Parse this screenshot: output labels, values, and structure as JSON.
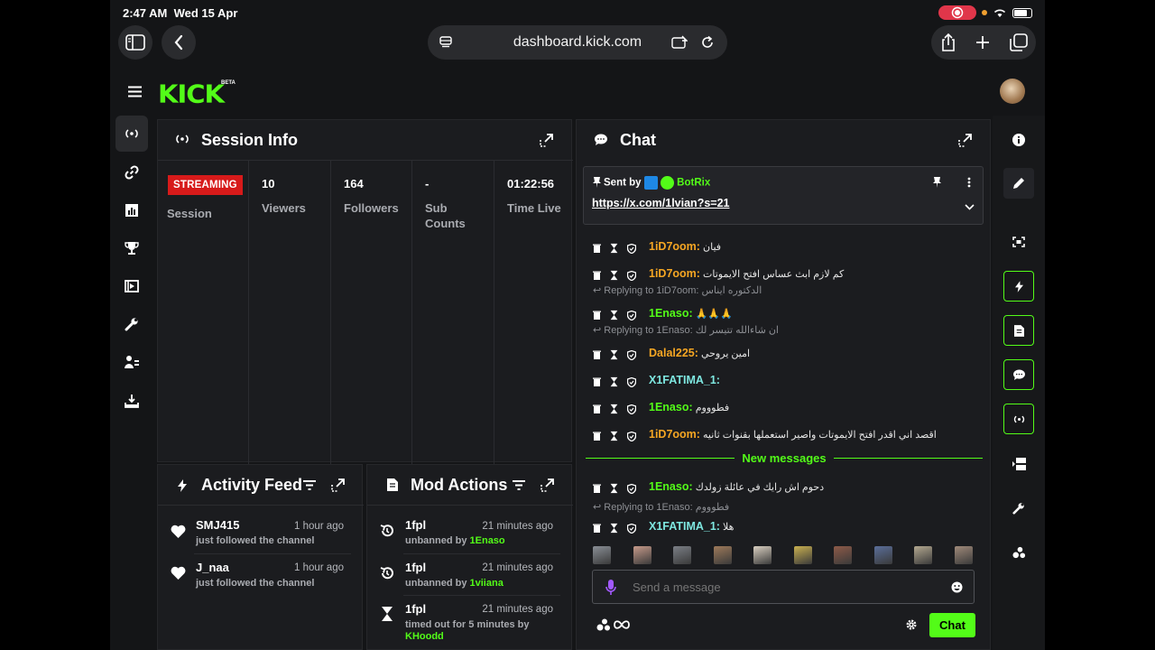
{
  "status": {
    "time": "2:47 AM",
    "date": "Wed 15 Apr"
  },
  "browser": {
    "url": "dashboard.kick.com"
  },
  "brand": {
    "logo": "KICK",
    "beta": "BETA",
    "accent": "#53fc18"
  },
  "session": {
    "title": "Session Info",
    "badge": "STREAMING",
    "badge_label": "Session",
    "stats": [
      {
        "value": "10",
        "label": "Viewers"
      },
      {
        "value": "164",
        "label": "Followers"
      },
      {
        "value": "-",
        "label": "Sub Counts"
      },
      {
        "value": "01:22:56",
        "label": "Time Live"
      }
    ]
  },
  "activity": {
    "title": "Activity Feed",
    "items": [
      {
        "user": "SMJ415",
        "time": "1 hour ago",
        "text": "just followed the channel"
      },
      {
        "user": "J_naa",
        "time": "1 hour ago",
        "text": "just followed the channel"
      }
    ]
  },
  "mod": {
    "title": "Mod Actions",
    "items": [
      {
        "user": "1fpl",
        "time": "21 minutes ago",
        "action": "unbanned by",
        "by": "1Enaso"
      },
      {
        "user": "1fpl",
        "time": "21 minutes ago",
        "action": "unbanned by",
        "by": "1viiana"
      },
      {
        "user": "1fpl",
        "time": "21 minutes ago",
        "action": "timed out for 5 minutes by",
        "by": "KHoodd"
      }
    ]
  },
  "chat": {
    "title": "Chat",
    "pinned": {
      "sent_by": "Sent by",
      "bot": "BotRix",
      "link": "https://x.com/1lvian?s=21"
    },
    "messages": [
      {
        "user": "1iD7oom:",
        "color": "#f5a623",
        "text": "فيان"
      },
      {
        "user": "1iD7oom:",
        "color": "#f5a623",
        "text": "كم لازم ابث عساس افتح الايموتات"
      },
      {
        "reply": "Replying to 1iD7oom: الدكتوره ايناس",
        "user": "1Enaso:",
        "color": "#53fc18",
        "text": "🙏🙏🙏"
      },
      {
        "reply": "Replying to 1Enaso: ان شاءالله تتيسر لك",
        "user": "Dalal225:",
        "color": "#f5a623",
        "text": "امين يروحي"
      },
      {
        "user": "X1FATIMA_1:",
        "color": "#7ee7e0",
        "text": ""
      },
      {
        "user": "1Enaso:",
        "color": "#53fc18",
        "text": "فطوووم"
      },
      {
        "user": "1iD7oom:",
        "color": "#f5a623",
        "text": "اقصد اني اقدر افتح الايموتات واصير استعملها بقنوات ثانيه"
      }
    ],
    "new_messages": "New messages",
    "messages_after": [
      {
        "user": "1Enaso:",
        "color": "#53fc18",
        "text": "دحوم اش رايك في عائلة زولدك"
      },
      {
        "reply": "Replying to 1Enaso: فطوووم",
        "user": "X1FATIMA_1:",
        "color": "#7ee7e0",
        "text": "هلا"
      }
    ],
    "input_placeholder": "Send a message",
    "send_label": "Chat"
  }
}
